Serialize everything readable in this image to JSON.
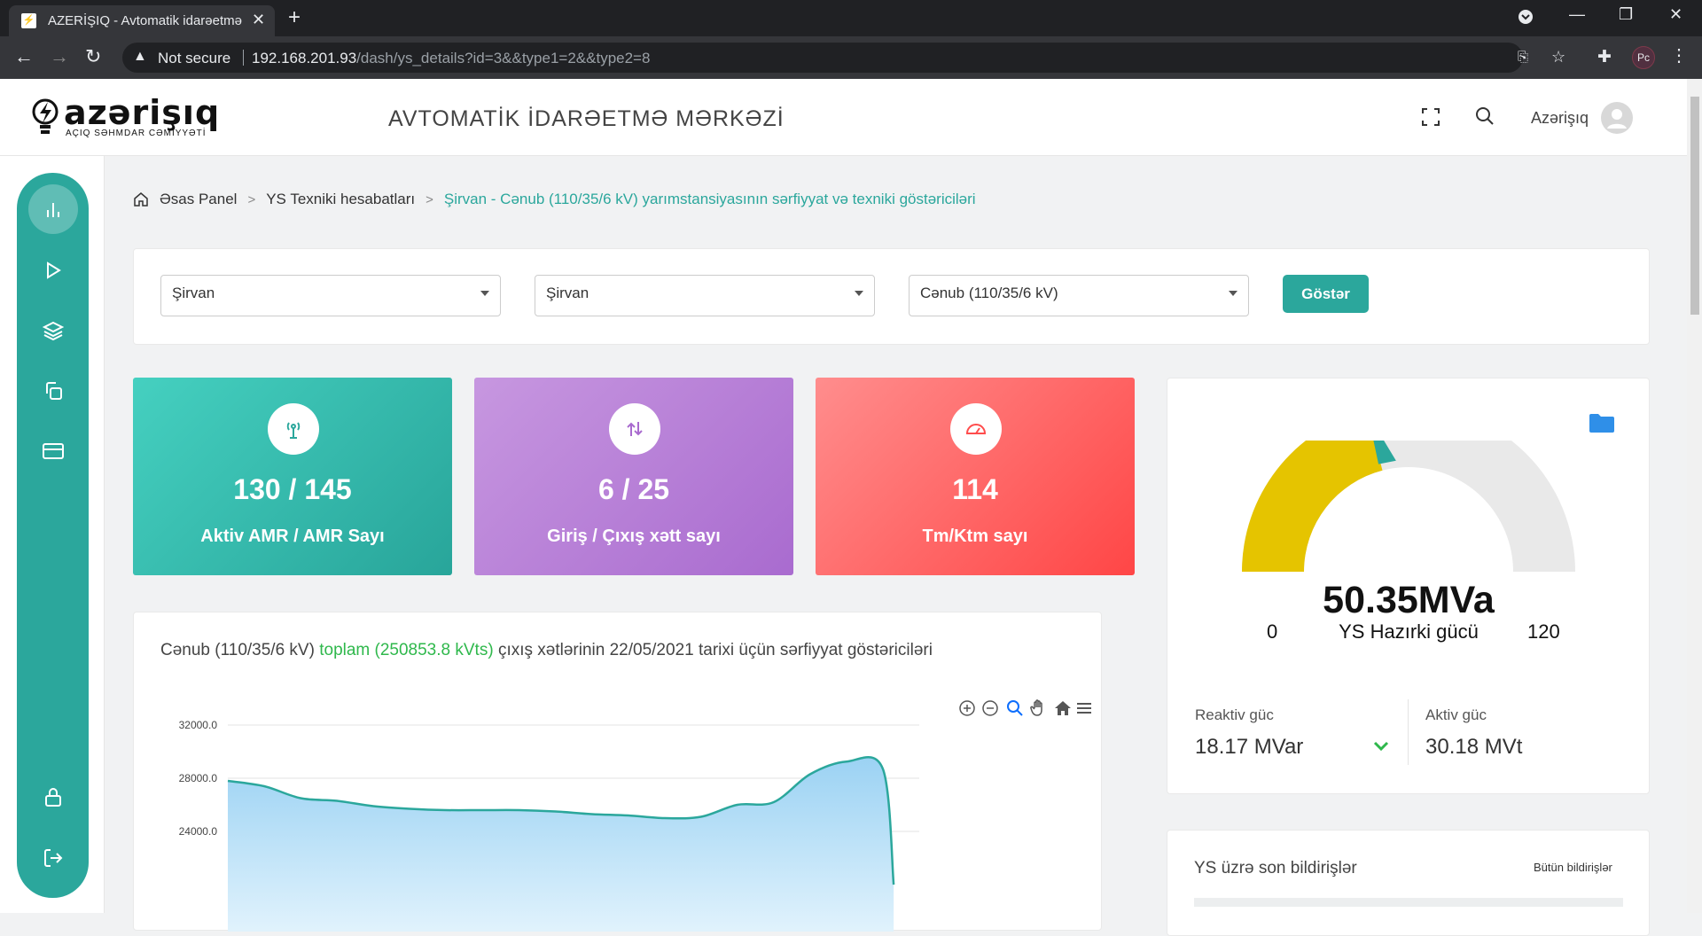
{
  "browser": {
    "tab_title": "AZERİŞIQ - Avtomatik idarəetmə",
    "not_secure": "Not secure",
    "url_host": "192.168.201.93",
    "url_path": "/dash/ys_details?id=3&&type1=2&&type2=8",
    "profile_initials": "Pc"
  },
  "header": {
    "logo_word": "azərişıq",
    "logo_sub": "AÇIQ SƏHMDAR CƏMİYYƏTİ",
    "title": "AVTOMATİK İDARƏETMƏ MƏRKƏZİ",
    "user": "Azərişıq"
  },
  "breadcrumb": {
    "home": "Əsas Panel",
    "reports": "YS Texniki hesabatları",
    "current": "Şirvan - Cənub (110/35/6 kV) yarımstansiyasının sərfiyyat və texniki göstəriciləri"
  },
  "filters": {
    "region": "Şirvan",
    "district": "Şirvan",
    "substation": "Cənub (110/35/6 kV)",
    "show_button": "Göstər"
  },
  "stats": [
    {
      "value": "130 / 145",
      "label": "Aktiv AMR / AMR Sayı"
    },
    {
      "value": "6 / 25",
      "label": "Giriş / Çıxış xətt sayı"
    },
    {
      "value": "114",
      "label": "Tm/Ktm sayı"
    }
  ],
  "consumption": {
    "title_prefix": "Cənub (110/35/6 kV)",
    "title_total": "toplam (250853.8 kVts)",
    "title_suffix": "çıxış xətlərinin 22/05/2021 tarixi üçün sərfiyyat göstəriciləri"
  },
  "chart_data": {
    "type": "area",
    "y_tick_labels": [
      "32000.0",
      "28000.0",
      "24000.0"
    ],
    "ylim": [
      20000,
      32000
    ],
    "values": [
      27800,
      27400,
      26500,
      26300,
      25900,
      25700,
      25600,
      25600,
      25600,
      25500,
      25300,
      25200,
      25000,
      25100,
      26000,
      26200,
      28300,
      29250,
      28700,
      20000
    ],
    "colors": {
      "line": "#2ba79c",
      "fill_top": "#9bd2f3",
      "fill_bottom": "#e4f4fd"
    }
  },
  "gauge": {
    "value_text": "50.35MVa",
    "label": "YS Hazırki gücü",
    "min": "0",
    "max": "120",
    "value": 50.35,
    "colors": {
      "fill": "#e5c400",
      "track": "#e9e9e9",
      "needle": "#2ba79c"
    }
  },
  "power": {
    "reactive_label": "Reaktiv güc",
    "reactive_value": "18.17 MVar",
    "active_label": "Aktiv güc",
    "active_value": "30.18 MVt"
  },
  "notifications": {
    "title": "YS üzrə son bildirişlər",
    "all_link": "Bütün bildirişlər"
  }
}
